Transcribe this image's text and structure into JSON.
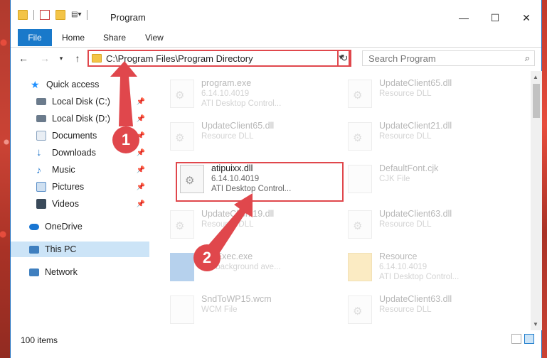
{
  "window": {
    "title": "Program",
    "minimize": "—",
    "maximize": "☐",
    "close": "✕"
  },
  "ribbon": {
    "file": "File",
    "tabs": [
      "Home",
      "Share",
      "View"
    ]
  },
  "address": {
    "path": "C:\\Program Files\\Program Directory",
    "search_placeholder": "Search Program"
  },
  "sidebar": {
    "items": [
      {
        "label": "Quick access",
        "icon": "star-icon",
        "color": "#1e90ff",
        "pinned": false
      },
      {
        "label": "Local Disk (C:)",
        "icon": "drive-icon",
        "color": "#6b7b8c",
        "pinned": true
      },
      {
        "label": "Local Disk (D:)",
        "icon": "drive-icon",
        "color": "#6b7b8c",
        "pinned": true
      },
      {
        "label": "Documents",
        "icon": "documents-icon",
        "color": "#8aa4c0",
        "pinned": true
      },
      {
        "label": "Downloads",
        "icon": "download-icon",
        "color": "#1e73c8",
        "pinned": true
      },
      {
        "label": "Music",
        "icon": "music-icon",
        "color": "#2a7ccf",
        "pinned": true
      },
      {
        "label": "Pictures",
        "icon": "pictures-icon",
        "color": "#5b8fc8",
        "pinned": true
      },
      {
        "label": "Videos",
        "icon": "videos-icon",
        "color": "#3a4a5a",
        "pinned": true
      },
      {
        "label": "OneDrive",
        "icon": "cloud-icon",
        "color": "#1976d2",
        "pinned": false
      },
      {
        "label": "This PC",
        "icon": "computer-icon",
        "color": "#3f7fbf",
        "pinned": false
      },
      {
        "label": "Network",
        "icon": "network-icon",
        "color": "#3f7fbf",
        "pinned": false
      }
    ]
  },
  "files": [
    {
      "name": "program.exe",
      "line1": "6.14.10.4019",
      "line2": "ATI Desktop Control...",
      "faded": true
    },
    {
      "name": "UpdateClient65.dll",
      "line1": "Resource DLL",
      "line2": "",
      "faded": true
    },
    {
      "name": "UpdateClient65.dll",
      "line1": "Resource DLL",
      "line2": "",
      "faded": true
    },
    {
      "name": "UpdateClient21.dll",
      "line1": "Resource DLL",
      "line2": "",
      "faded": true
    },
    {
      "name": "atipuixx.dll",
      "line1": "6.14.10.4019",
      "line2": "ATI Desktop Control...",
      "faded": false
    },
    {
      "name": "DefaultFont.cjk",
      "line1": "CJK File",
      "line2": "",
      "faded": true
    },
    {
      "name": "UpdateClient19.dll",
      "line1": "Resource DLL",
      "line2": "",
      "faded": true
    },
    {
      "name": "UpdateClient63.dll",
      "line1": "Resource DLL",
      "line2": "",
      "faded": true
    },
    {
      "name": "SysExec.exe",
      "line1": "...Y background ave...",
      "line2": "",
      "faded": true
    },
    {
      "name": "Resource",
      "line1": "6.14.10.4019",
      "line2": "ATI Desktop Control...",
      "faded": true
    },
    {
      "name": "SndToWP15.wcm",
      "line1": "WCM File",
      "line2": "",
      "faded": true
    },
    {
      "name": "UpdateClient63.dll",
      "line1": "Resource DLL",
      "line2": "",
      "faded": true
    }
  ],
  "status": {
    "items_count": "100 items"
  },
  "callouts": [
    "1",
    "2"
  ],
  "colors": {
    "accent": "#1979ca",
    "highlight_red": "#e0474c",
    "selected_bg": "#cce4f7"
  }
}
